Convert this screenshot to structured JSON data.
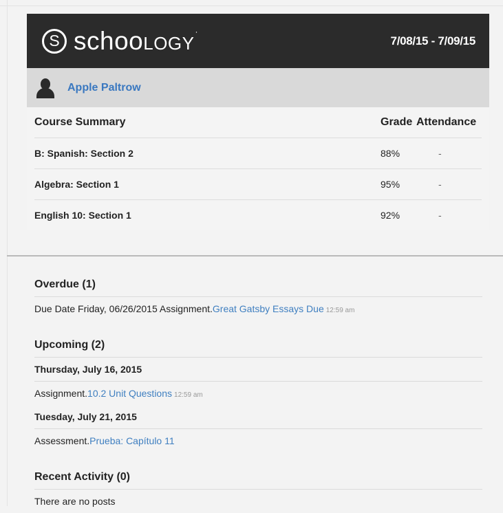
{
  "header": {
    "logo_circle": "S",
    "logo_text_lower": "schoo",
    "logo_text_accent": "logy",
    "logo_mark": "·",
    "date_range": "7/08/15 - 7/09/15"
  },
  "student": {
    "name": "Apple Paltrow",
    "avatar_icon": "user-silhouette-icon"
  },
  "course_summary": {
    "header_course": "Course Summary",
    "header_grade": "Grade",
    "header_attendance": "Attendance",
    "rows": [
      {
        "course": "B: Spanish: Section 2",
        "grade": "88%",
        "attendance": "-"
      },
      {
        "course": "Algebra: Section 1",
        "grade": "95%",
        "attendance": "-"
      },
      {
        "course": "English 10: Section 1",
        "grade": "92%",
        "attendance": "-"
      }
    ]
  },
  "overdue": {
    "title": "Overdue (1)",
    "items": [
      {
        "prefix": "Due Date Friday, 06/26/2015 Assignment.",
        "link": "Great Gatsby Essays Due",
        "time": "12:59 am"
      }
    ]
  },
  "upcoming": {
    "title": "Upcoming (2)",
    "groups": [
      {
        "date": "Thursday, July 16, 2015",
        "prefix": "Assignment.",
        "link": "10.2 Unit Questions",
        "time": "12:59 am"
      },
      {
        "date": "Tuesday, July 21, 2015",
        "prefix": "Assessment.",
        "link": "Prueba: Capítulo 11",
        "time": ""
      }
    ]
  },
  "recent_activity": {
    "title": "Recent Activity (0)",
    "empty_text": "There are no posts"
  },
  "colors": {
    "header_bg": "#2b2b2b",
    "link": "#3f7fc0",
    "student_bar_bg": "#d9d9d9"
  }
}
